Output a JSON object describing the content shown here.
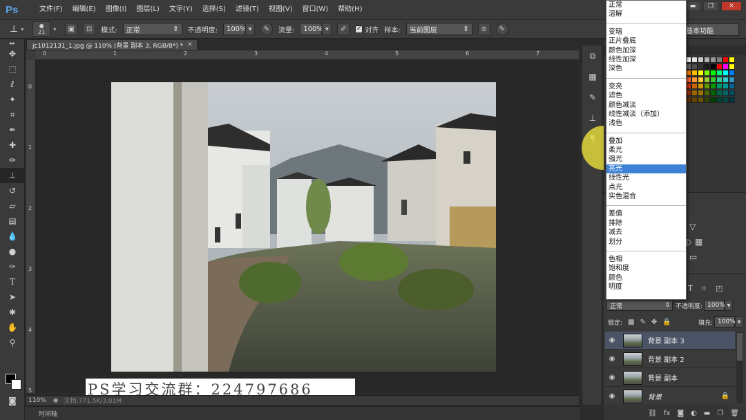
{
  "app": {
    "logo": "Ps"
  },
  "menu": [
    "文件(F)",
    "编辑(E)",
    "图像(I)",
    "图层(L)",
    "文字(Y)",
    "选择(S)",
    "滤镜(T)",
    "视图(V)",
    "窗口(W)",
    "帮助(H)"
  ],
  "window_controls": {
    "minimize": "▬",
    "restore": "❐",
    "close": "✕"
  },
  "options": {
    "brush_size": "21",
    "mode_label": "模式:",
    "mode_value": "正常",
    "opacity_label": "不透明度:",
    "opacity_value": "100%",
    "flow_label": "流量:",
    "flow_value": "100%",
    "align_label": "对齐",
    "sample_label": "样本:",
    "sample_value": "当前图层",
    "workspace_value": "基本功能"
  },
  "document": {
    "tab_title": "jc1012131_1.jpg @ 110% (背景 副本 3, RGB/8*) *",
    "ruler_h": [
      "0",
      "1",
      "2",
      "3",
      "4",
      "5",
      "6",
      "7"
    ],
    "ruler_v": [
      "0",
      "1",
      "2",
      "3",
      "4",
      "5"
    ],
    "zoom": "110%",
    "status_text": "文档:771.5K/3.01M",
    "watermark": "PS学习交流群：224797686"
  },
  "timeline_label": "时间轴",
  "blend_modes": {
    "groups": [
      [
        "正常",
        "溶解"
      ],
      [
        "变暗",
        "正片叠底",
        "颜色加深",
        "线性加深",
        "深色"
      ],
      [
        "变亮",
        "滤色",
        "颜色减淡",
        "线性减淡（添加）",
        "浅色"
      ],
      [
        "叠加",
        "柔光",
        "强光",
        "亮光",
        "线性光",
        "点光",
        "实色混合"
      ],
      [
        "差值",
        "排除",
        "减去",
        "划分"
      ],
      [
        "色相",
        "饱和度",
        "颜色",
        "明度"
      ]
    ],
    "highlighted": "亮光"
  },
  "layers_panel": {
    "blend_value": "正常",
    "opacity_label": "不透明度:",
    "opacity_value": "100%",
    "lock_label": "锁定:",
    "fill_label": "填充:",
    "fill_value": "100%",
    "layers": [
      {
        "name": "背景 副本 3",
        "selected": true,
        "visible": true
      },
      {
        "name": "背景 副本 2",
        "selected": false,
        "visible": true
      },
      {
        "name": "背景 副本",
        "selected": false,
        "visible": true
      },
      {
        "name": "背景",
        "selected": false,
        "visible": true,
        "locked": true,
        "italic": true
      }
    ]
  },
  "colors": {
    "accent": "#3d82d4",
    "foreground": "#000000",
    "background": "#ffffff",
    "highlight_halo": "#f0e63c"
  }
}
